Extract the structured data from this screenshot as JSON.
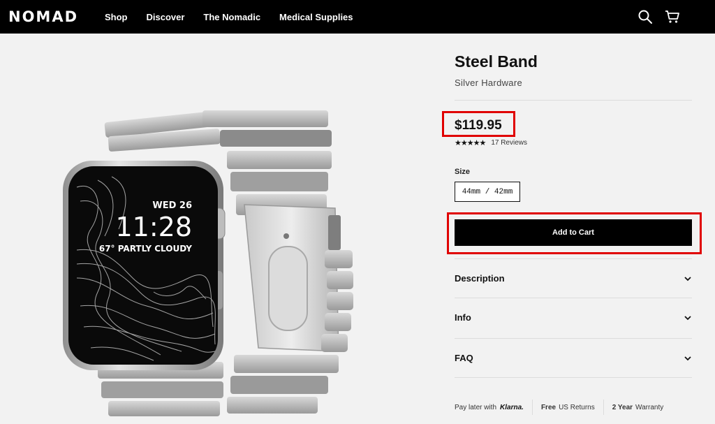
{
  "header": {
    "logo": "NOMAD",
    "nav": [
      "Shop",
      "Discover",
      "The Nomadic",
      "Medical Supplies"
    ],
    "icons": [
      "search-icon",
      "cart-icon"
    ]
  },
  "watch_screen": {
    "date": "WED 26",
    "time": "11:28",
    "weather": "67° PARTLY CLOUDY"
  },
  "product": {
    "title": "Steel Band",
    "subtitle": "Silver Hardware",
    "price": "$119.95",
    "rating_stars": "★★★★★",
    "rating_value": 5,
    "reviews": "17 Reviews",
    "size_label": "Size",
    "size_selected": "44mm / 42mm",
    "cta": "Add to Cart",
    "accordions": [
      "Description",
      "Info",
      "FAQ"
    ]
  },
  "footer_strip": {
    "pay_later": "Pay later with",
    "klarna": "Klarna.",
    "free": "Free",
    "returns": "US Returns",
    "warranty_years": "2 Year",
    "warranty": "Warranty"
  },
  "colors": {
    "header_bg": "#000000",
    "page_bg": "#f2f2f2",
    "cta_bg": "#000000",
    "highlight": "#e00000"
  }
}
